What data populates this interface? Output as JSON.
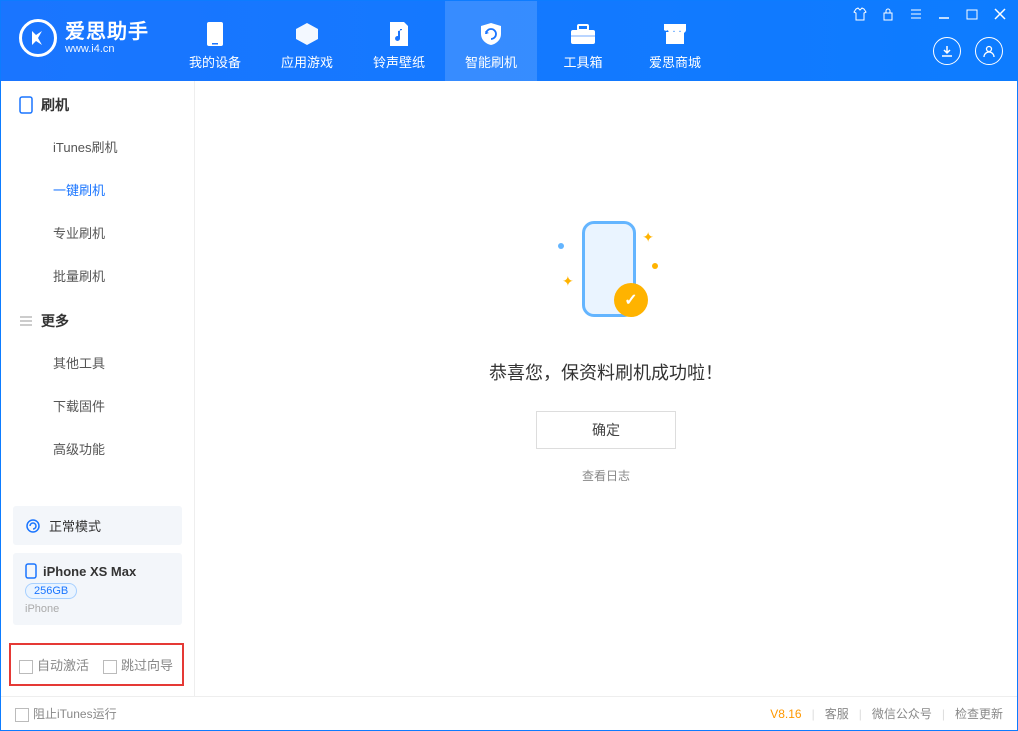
{
  "app": {
    "title": "爱思助手",
    "subtitle": "www.i4.cn"
  },
  "nav": {
    "tabs": [
      {
        "label": "我的设备"
      },
      {
        "label": "应用游戏"
      },
      {
        "label": "铃声壁纸"
      },
      {
        "label": "智能刷机"
      },
      {
        "label": "工具箱"
      },
      {
        "label": "爱思商城"
      }
    ]
  },
  "sidebar": {
    "cat1": "刷机",
    "items1": [
      {
        "label": "iTunes刷机"
      },
      {
        "label": "一键刷机"
      },
      {
        "label": "专业刷机"
      },
      {
        "label": "批量刷机"
      }
    ],
    "cat2": "更多",
    "items2": [
      {
        "label": "其他工具"
      },
      {
        "label": "下载固件"
      },
      {
        "label": "高级功能"
      }
    ],
    "mode": "正常模式",
    "device": {
      "name": "iPhone XS Max",
      "storage": "256GB",
      "type": "iPhone"
    },
    "opts": {
      "auto_activate": "自动激活",
      "skip_guide": "跳过向导"
    }
  },
  "main": {
    "success": "恭喜您，保资料刷机成功啦！",
    "ok": "确定",
    "viewlog": "查看日志"
  },
  "footer": {
    "block_itunes": "阻止iTunes运行",
    "version": "V8.16",
    "support": "客服",
    "wechat": "微信公众号",
    "update": "检查更新"
  }
}
